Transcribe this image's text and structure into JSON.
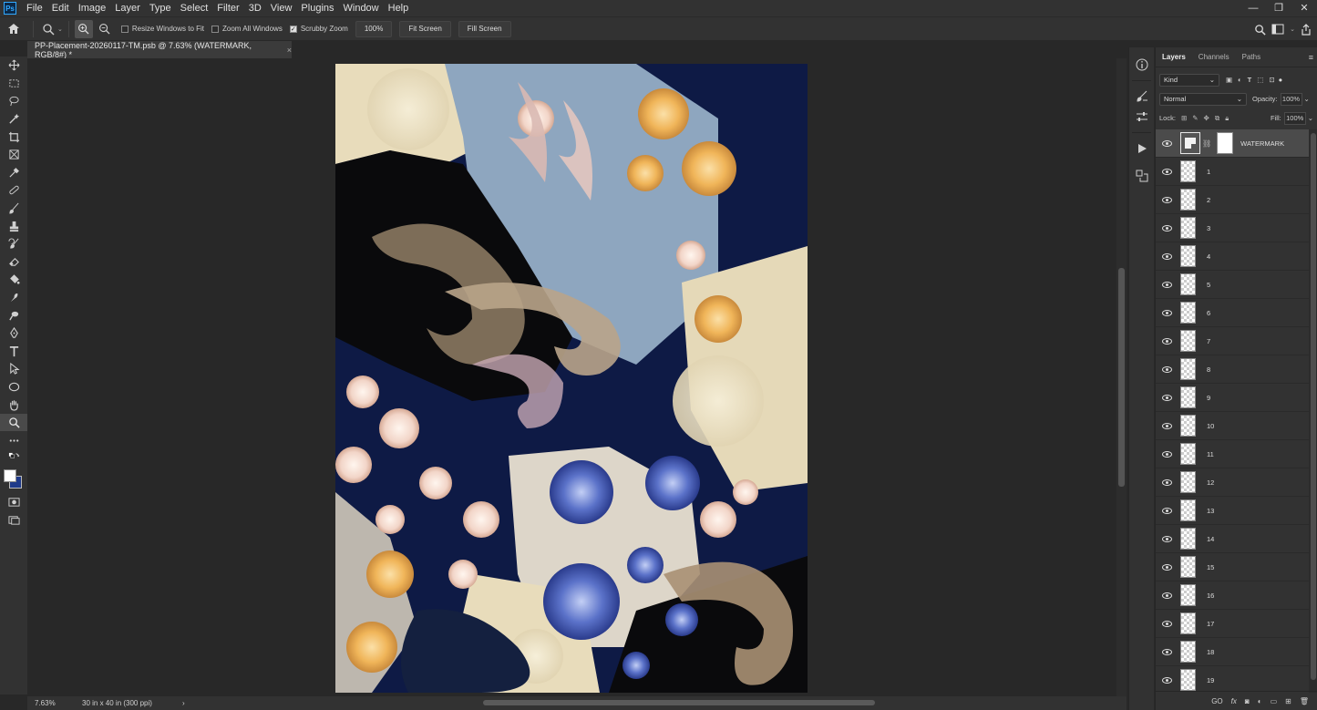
{
  "menu": {
    "logo": "Ps",
    "items": [
      "File",
      "Edit",
      "Image",
      "Layer",
      "Type",
      "Select",
      "Filter",
      "3D",
      "View",
      "Plugins",
      "Window",
      "Help"
    ]
  },
  "window_controls": {
    "minimize": "—",
    "restore": "❐",
    "close": "✕"
  },
  "options": {
    "resize_windows": "Resize Windows to Fit",
    "zoom_all": "Zoom All Windows",
    "scrubby_zoom": "Scrubby Zoom",
    "zoom_100": "100%",
    "fit_screen": "Fit Screen",
    "fill_screen": "Fill Screen",
    "resize_checked": false,
    "zoom_all_checked": false,
    "scrubby_checked": true
  },
  "document": {
    "tab_title": "PP-Placement-20260117-TM.psb @ 7.63% (WATERMARK, RGB/8#) *",
    "close": "×"
  },
  "status": {
    "zoom": "7.63%",
    "dimensions": "30 in x 40 in (300 ppi)",
    "arrow": "›"
  },
  "layers_panel": {
    "tabs": [
      "Layers",
      "Channels",
      "Paths"
    ],
    "filter_kind": "Kind",
    "blend_mode": "Normal",
    "opacity_label": "Opacity:",
    "opacity_value": "100%",
    "lock_label": "Lock:",
    "fill_label": "Fill:",
    "fill_value": "100%",
    "selected_layer": "WATERMARK",
    "layers": [
      "1",
      "2",
      "3",
      "4",
      "5",
      "6",
      "7",
      "8",
      "9",
      "10",
      "11",
      "12",
      "13",
      "14",
      "15",
      "16",
      "17",
      "18",
      "19"
    ],
    "footer": [
      "GO",
      "fx"
    ]
  },
  "colors": {
    "accent": "#31a8ff",
    "background_swatch": "#ffffff",
    "foreground_swatch": "#1f3a8a"
  }
}
